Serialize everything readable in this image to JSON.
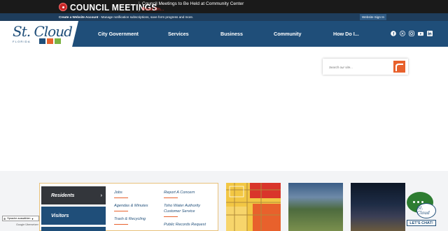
{
  "alert": {
    "title": "COUNCIL MEETINGS",
    "message": "Council Meetings to Be Held at Community Center",
    "read_more": "Read On..."
  },
  "account_bar": {
    "create_label": "Create a Website Account",
    "create_desc": " - Manage notification subscriptions, save form progress and more.",
    "sign_in": "Website Sign In"
  },
  "logo": {
    "script": "St. Cloud",
    "state": "FLORIDA"
  },
  "nav": {
    "items": [
      "City Government",
      "Services",
      "Business",
      "Community",
      "How Do I..."
    ]
  },
  "social": [
    "facebook-icon",
    "x-icon",
    "instagram-icon",
    "youtube-icon",
    "linkedin-icon"
  ],
  "search": {
    "placeholder": "Search our site..."
  },
  "side_tabs": [
    "Residents",
    "Visitors"
  ],
  "links_col1": [
    "Jobs",
    "Agendas & Minutes",
    "Trash & Recycling"
  ],
  "links_col2": [
    "Report A Concern",
    "Toho Water Authority Customer Service",
    "Public Records Request"
  ],
  "chat": {
    "label": "LET'S CHAT!",
    "logo_text": "St. Cloud"
  },
  "translate": {
    "language": "Sprache auswählen",
    "powered_by": "Google Übersetzer"
  },
  "colors": {
    "navy": "#1f4e79",
    "dark_bar": "#1a1a1a",
    "accent_orange": "#e8612c",
    "alert_red": "#e53935",
    "chat_green": "#2e7d32"
  }
}
